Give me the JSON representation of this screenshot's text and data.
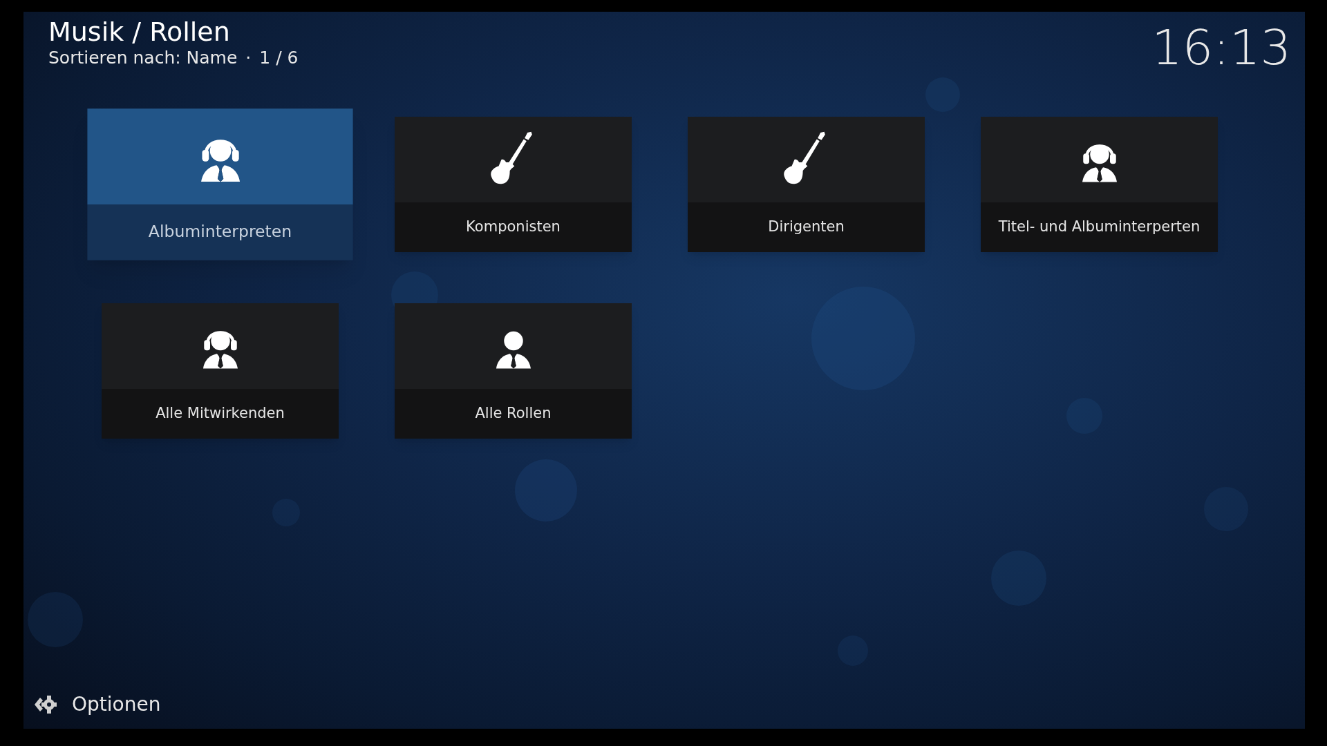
{
  "header": {
    "title": "Musik / Rollen",
    "sort_label": "Sortieren nach: Name",
    "separator": "·",
    "position": "1 / 6"
  },
  "clock": "16:13",
  "items": [
    {
      "label": "Albuminterpreten",
      "kind": "headphones",
      "selected": true
    },
    {
      "label": "Komponisten",
      "kind": "guitar",
      "selected": false
    },
    {
      "label": "Dirigenten",
      "kind": "guitar",
      "selected": false
    },
    {
      "label": "Titel- und Albuminterperten",
      "kind": "headphones",
      "selected": false
    },
    {
      "label": "Alle Mitwirkenden",
      "kind": "headphones",
      "selected": false
    },
    {
      "label": "Alle Rollen",
      "kind": "person",
      "selected": false
    }
  ],
  "options_button": {
    "label": "Optionen"
  }
}
